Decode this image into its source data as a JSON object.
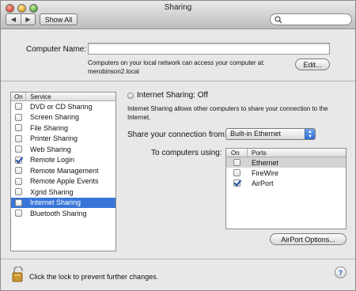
{
  "window": {
    "title": "Sharing"
  },
  "toolbar": {
    "back_label": "◀",
    "forward_label": "▶",
    "show_all_label": "Show All",
    "search_placeholder": ""
  },
  "computer_name": {
    "label": "Computer Name:",
    "value": "",
    "note_line1": "Computers on your local network can access your computer at:",
    "note_line2": "merobinson2.local",
    "edit_label": "Edit..."
  },
  "services": {
    "col_on": "On",
    "col_service": "Service",
    "items": [
      {
        "label": "DVD or CD Sharing",
        "checked": false,
        "selected": false
      },
      {
        "label": "Screen Sharing",
        "checked": false,
        "selected": false
      },
      {
        "label": "File Sharing",
        "checked": false,
        "selected": false
      },
      {
        "label": "Printer Sharing",
        "checked": false,
        "selected": false
      },
      {
        "label": "Web Sharing",
        "checked": false,
        "selected": false
      },
      {
        "label": "Remote Login",
        "checked": true,
        "selected": false
      },
      {
        "label": "Remote Management",
        "checked": false,
        "selected": false
      },
      {
        "label": "Remote Apple Events",
        "checked": false,
        "selected": false
      },
      {
        "label": "Xgrid Sharing",
        "checked": false,
        "selected": false
      },
      {
        "label": "Internet Sharing",
        "checked": false,
        "selected": true
      },
      {
        "label": "Bluetooth Sharing",
        "checked": false,
        "selected": false
      }
    ]
  },
  "detail": {
    "status_title": "Internet Sharing: Off",
    "description_line1": "Internet Sharing allows other computers to share your connection to the",
    "description_line2": "Internet.",
    "share_from_label": "Share your connection from:",
    "share_from_value": "Built-in Ethernet",
    "to_computers_label": "To computers using:",
    "ports": {
      "col_on": "On",
      "col_ports": "Ports",
      "items": [
        {
          "label": "Ethernet",
          "checked": false,
          "highlighted": true
        },
        {
          "label": "FireWire",
          "checked": false,
          "highlighted": false
        },
        {
          "label": "AirPort",
          "checked": true,
          "highlighted": false
        }
      ]
    },
    "airport_options_label": "AirPort Options..."
  },
  "footer": {
    "lock_text": "Click the lock to prevent further changes.",
    "help_label": "?"
  },
  "colors": {
    "selection": "#3875d7",
    "checkmark": "#1b4fa8"
  }
}
